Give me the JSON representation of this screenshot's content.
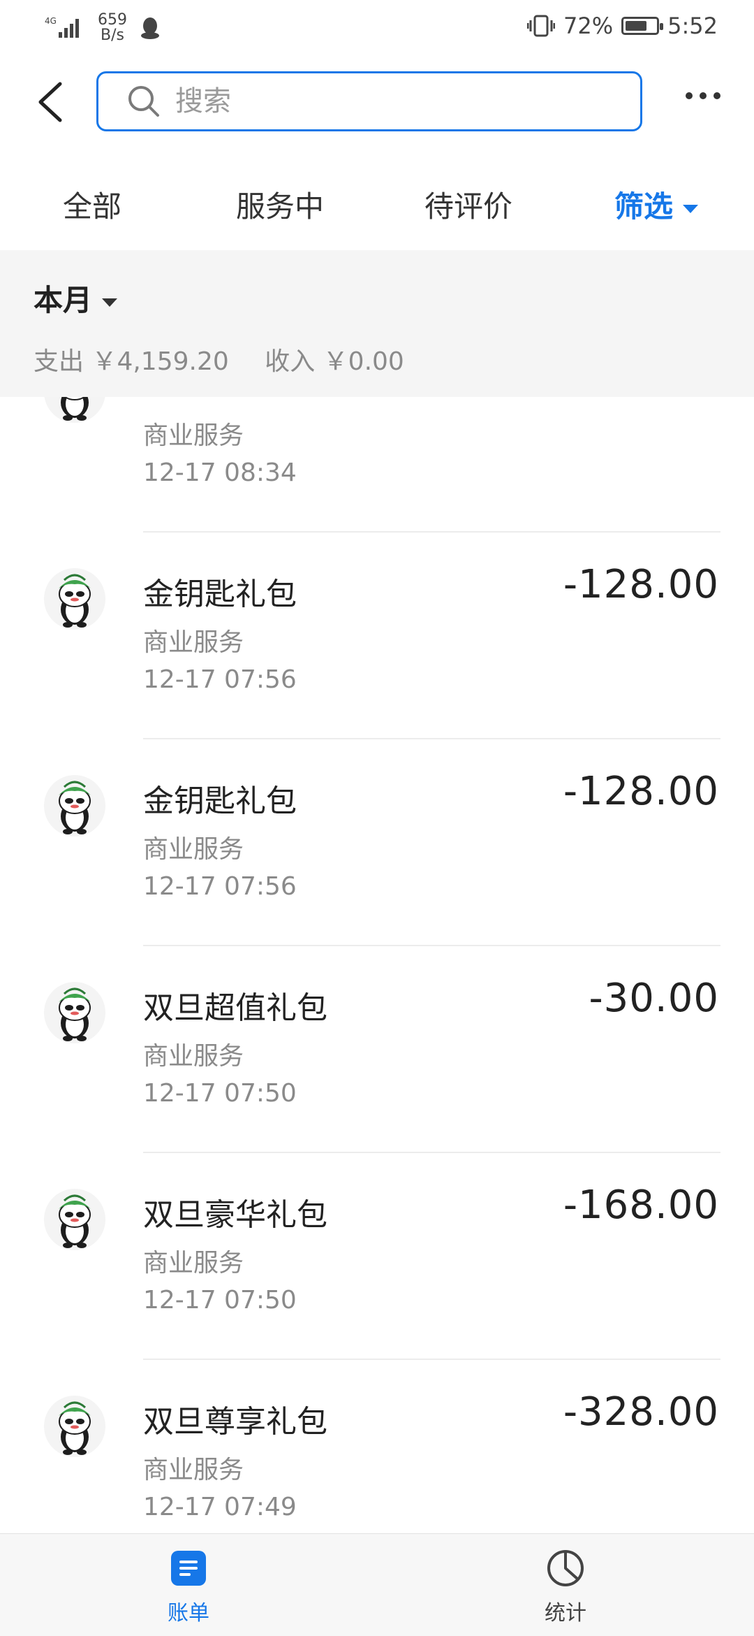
{
  "status_bar": {
    "network": "4G",
    "speed_value": "659",
    "speed_unit": "B/s",
    "battery": "72%",
    "battery_level": 0.72,
    "time": "5:52"
  },
  "header": {
    "search_placeholder": "搜索"
  },
  "tabs": [
    {
      "label": "全部"
    },
    {
      "label": "服务中"
    },
    {
      "label": "待评价"
    },
    {
      "label": "筛选"
    }
  ],
  "summary": {
    "month_label": "本月",
    "expense": "支出 ￥4,159.20",
    "income": "收入 ￥0.00"
  },
  "transactions": [
    {
      "title": "",
      "category": "商业服务",
      "time": "12-17  08:34",
      "amount": ""
    },
    {
      "title": "金钥匙礼包",
      "category": "商业服务",
      "time": "12-17  07:56",
      "amount": "-128.00"
    },
    {
      "title": "金钥匙礼包",
      "category": "商业服务",
      "time": "12-17  07:56",
      "amount": "-128.00"
    },
    {
      "title": "双旦超值礼包",
      "category": "商业服务",
      "time": "12-17  07:50",
      "amount": "-30.00"
    },
    {
      "title": "双旦豪华礼包",
      "category": "商业服务",
      "time": "12-17  07:50",
      "amount": "-168.00"
    },
    {
      "title": "双旦尊享礼包",
      "category": "商业服务",
      "time": "12-17  07:49",
      "amount": "-328.00"
    }
  ],
  "bottom_nav": [
    {
      "label": "账单",
      "icon": "bill-icon",
      "active": true
    },
    {
      "label": "统计",
      "icon": "pie-chart-icon",
      "active": false
    }
  ],
  "colors": {
    "accent": "#1677e8",
    "avatar_green": "#3fa34d"
  }
}
